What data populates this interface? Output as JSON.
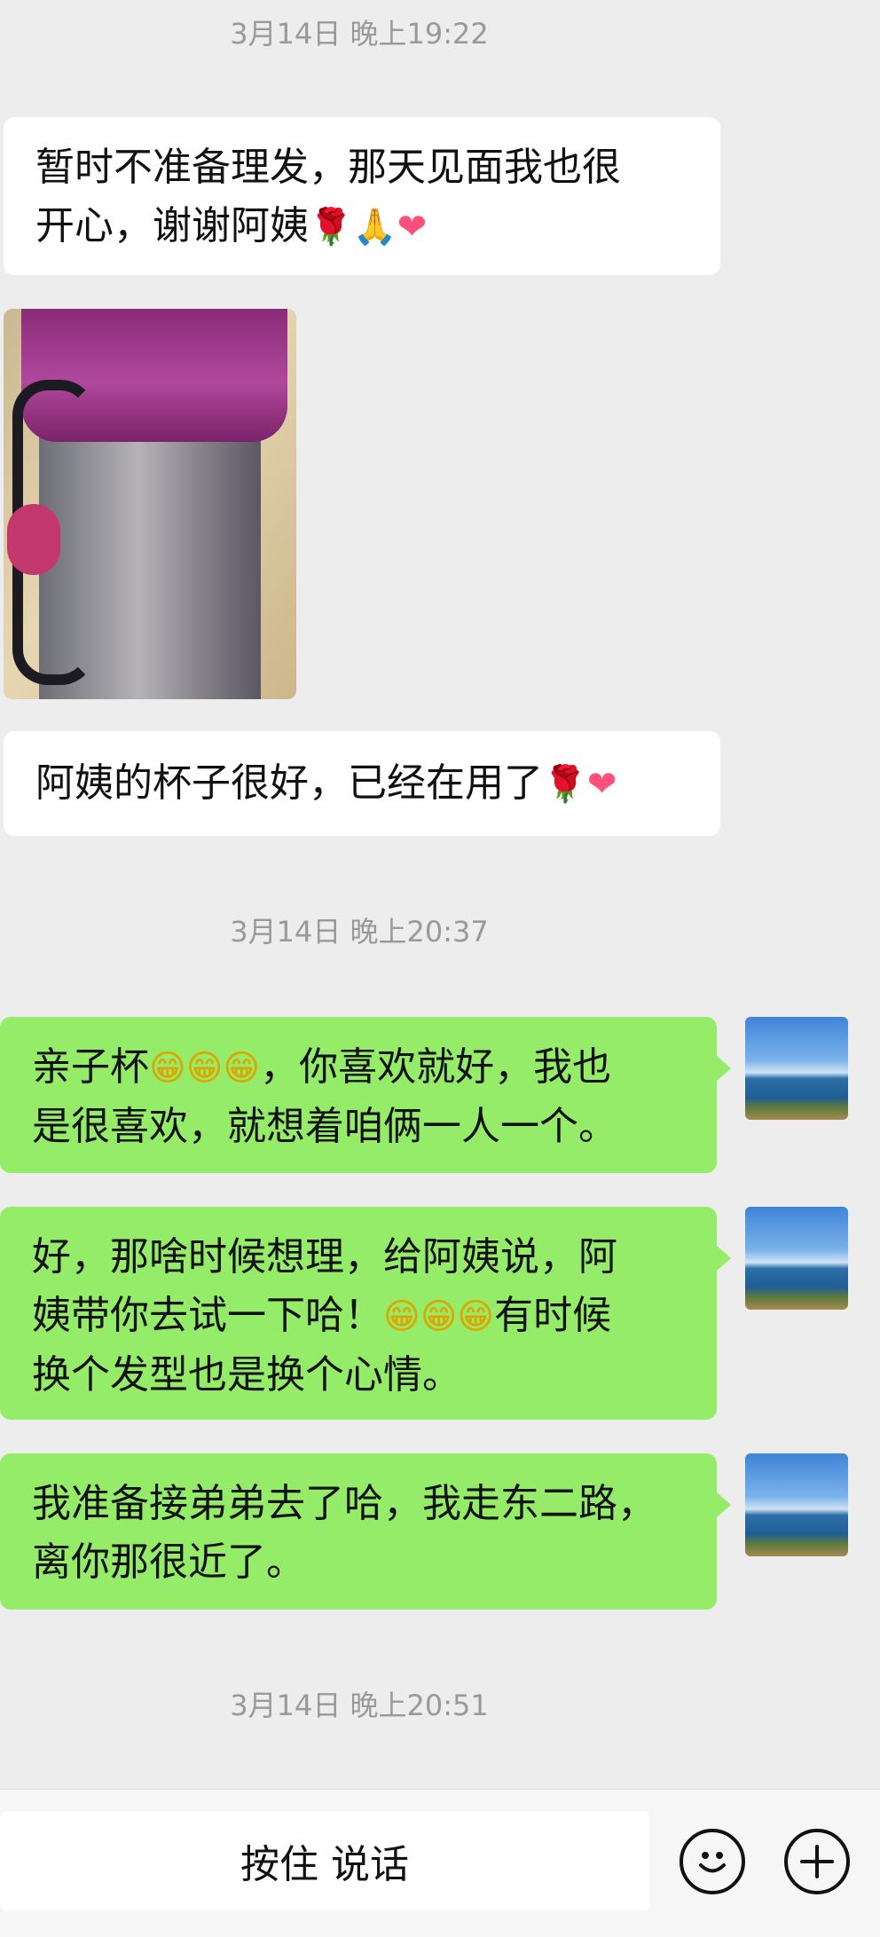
{
  "timestamps": [
    "3月14日 晚上19:22",
    "3月14日 晚上20:37",
    "3月14日 晚上20:51"
  ],
  "messages": {
    "m1": {
      "line1": "暂时不准备理发，那天见面我也很",
      "line2": "开心，谢谢阿姨",
      "emoji": [
        "🌹",
        "🙏",
        "❤"
      ]
    },
    "m2": {
      "text": "阿姨的杯子很好，已经在用了",
      "emoji": [
        "🌹",
        "❤"
      ]
    },
    "m3": {
      "part1": "亲子杯",
      "part2": "，你喜欢就好，我也",
      "line2": "是很喜欢，就想着咱俩一人一个。",
      "emoji": "😁"
    },
    "m4": {
      "line1": "好，那啥时候想理，给阿姨说，阿",
      "line2a": "姨带你去试一下哈！",
      "line2b": "有时候",
      "line3": "换个发型也是换个心情。",
      "emoji": "😁"
    },
    "m5": {
      "line1": "我准备接弟弟去了哈，我走东二路，",
      "line2": "离你那很近了。"
    }
  },
  "input_bar": {
    "hold_to_talk": "按住 说话",
    "emoji_icon": "emoji-icon",
    "plus_icon": "plus-icon"
  },
  "colors": {
    "background": "#ededed",
    "incoming_bubble": "#ffffff",
    "outgoing_bubble": "#95ec69",
    "timestamp_text": "#999999"
  }
}
